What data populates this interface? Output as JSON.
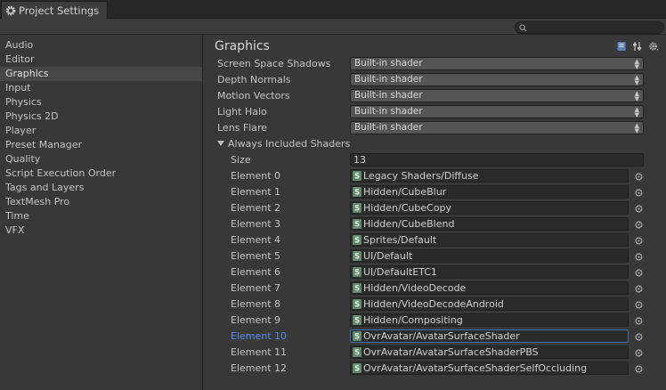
{
  "window": {
    "tab_title": "Project Settings",
    "search_placeholder": ""
  },
  "sidebar": {
    "items": [
      {
        "label": "Audio",
        "selected": false
      },
      {
        "label": "Editor",
        "selected": false
      },
      {
        "label": "Graphics",
        "selected": true
      },
      {
        "label": "Input",
        "selected": false
      },
      {
        "label": "Physics",
        "selected": false
      },
      {
        "label": "Physics 2D",
        "selected": false
      },
      {
        "label": "Player",
        "selected": false
      },
      {
        "label": "Preset Manager",
        "selected": false
      },
      {
        "label": "Quality",
        "selected": false
      },
      {
        "label": "Script Execution Order",
        "selected": false
      },
      {
        "label": "Tags and Layers",
        "selected": false
      },
      {
        "label": "TextMesh Pro",
        "selected": false
      },
      {
        "label": "Time",
        "selected": false
      },
      {
        "label": "VFX",
        "selected": false
      }
    ]
  },
  "main": {
    "title": "Graphics",
    "settings": [
      {
        "label": "Screen Space Shadows",
        "value": "Built-in shader"
      },
      {
        "label": "Depth Normals",
        "value": "Built-in shader"
      },
      {
        "label": "Motion Vectors",
        "value": "Built-in shader"
      },
      {
        "label": "Light Halo",
        "value": "Built-in shader"
      },
      {
        "label": "Lens Flare",
        "value": "Built-in shader"
      }
    ],
    "always_included": {
      "header": "Always Included Shaders",
      "size_label": "Size",
      "size_value": "13",
      "elements": [
        {
          "label": "Element 0",
          "value": "Legacy Shaders/Diffuse",
          "focused": false
        },
        {
          "label": "Element 1",
          "value": "Hidden/CubeBlur",
          "focused": false
        },
        {
          "label": "Element 2",
          "value": "Hidden/CubeCopy",
          "focused": false
        },
        {
          "label": "Element 3",
          "value": "Hidden/CubeBlend",
          "focused": false
        },
        {
          "label": "Element 4",
          "value": "Sprites/Default",
          "focused": false
        },
        {
          "label": "Element 5",
          "value": "UI/Default",
          "focused": false
        },
        {
          "label": "Element 6",
          "value": "UI/DefaultETC1",
          "focused": false
        },
        {
          "label": "Element 7",
          "value": "Hidden/VideoDecode",
          "focused": false
        },
        {
          "label": "Element 8",
          "value": "Hidden/VideoDecodeAndroid",
          "focused": false
        },
        {
          "label": "Element 9",
          "value": "Hidden/Compositing",
          "focused": false
        },
        {
          "label": "Element 10",
          "value": "OvrAvatar/AvatarSurfaceShader",
          "focused": true
        },
        {
          "label": "Element 11",
          "value": "OvrAvatar/AvatarSurfaceShaderPBS",
          "focused": false
        },
        {
          "label": "Element 12",
          "value": "OvrAvatar/AvatarSurfaceShaderSelfOccluding",
          "focused": false
        }
      ]
    }
  },
  "colors": {
    "background": "#383838",
    "selection": "#474747",
    "focus_label": "#5a8cf0",
    "field": "#2b2b2b",
    "dropdown": "#555555"
  },
  "icons": [
    "settings-gear-icon",
    "search-icon",
    "help-book-icon",
    "preset-sliders-icon",
    "gear-menu-icon",
    "shader-icon",
    "object-picker-icon"
  ]
}
